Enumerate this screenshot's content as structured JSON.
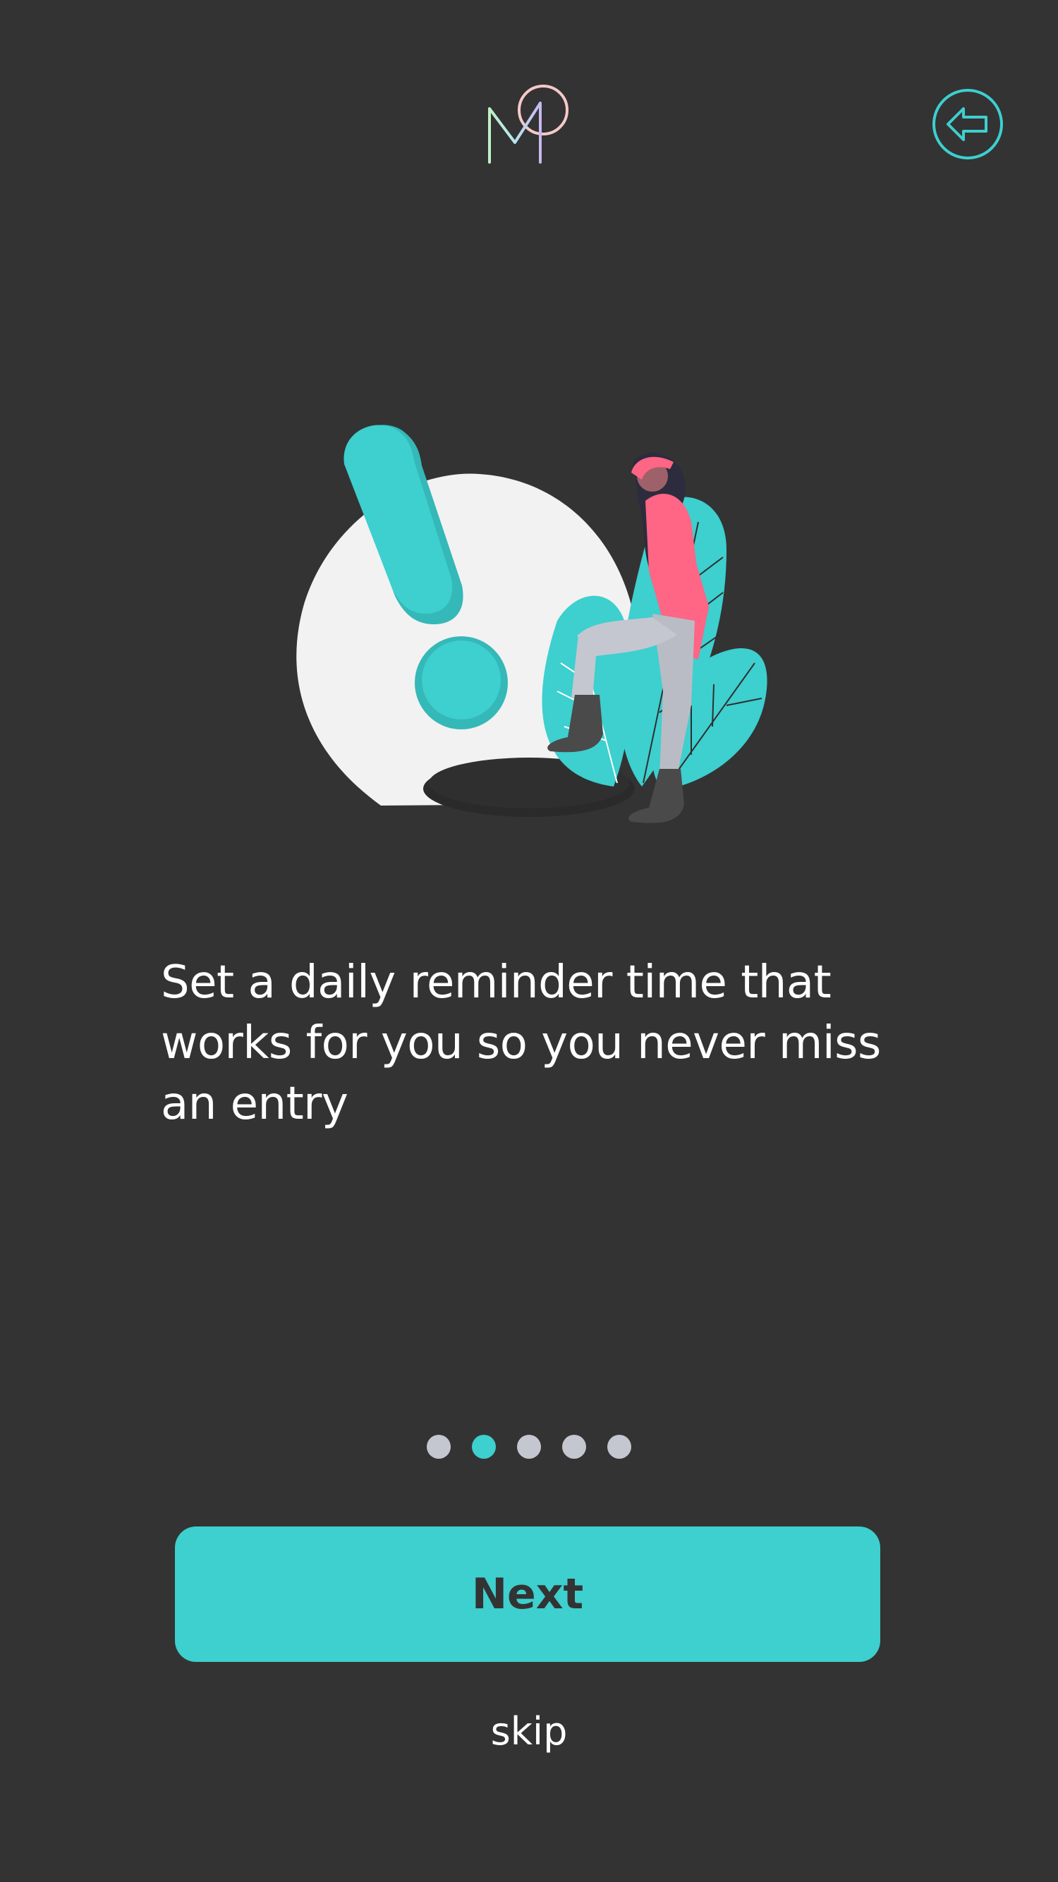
{
  "header": {
    "logo_icon": "app-logo-m-circle",
    "back_icon": "back-arrow-icon"
  },
  "onboarding": {
    "illustration": "woman-with-exclamation-mark-reminder",
    "message": "Set a daily reminder time that works for you so you never miss an entry",
    "current_step": 2,
    "total_steps": 5
  },
  "actions": {
    "next_label": "Next",
    "skip_label": "skip"
  },
  "colors": {
    "background": "#333333",
    "accent": "#3ecfcf",
    "dot_inactive": "#c4c7d0",
    "text": "#ffffff"
  }
}
